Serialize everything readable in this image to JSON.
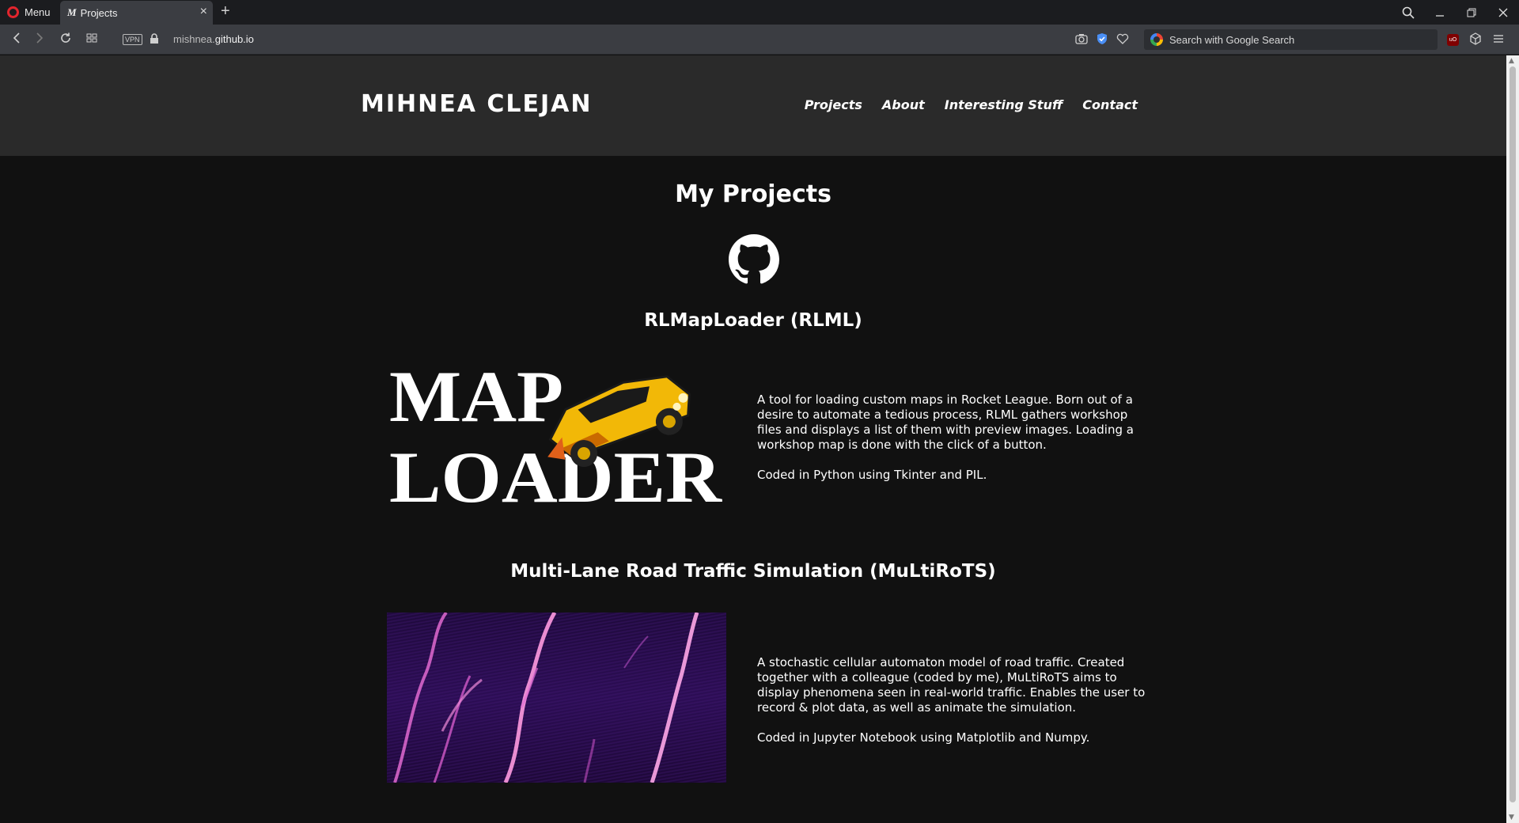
{
  "browser": {
    "menu_label": "Menu",
    "tab": {
      "favicon": "M",
      "title": "Projects"
    },
    "url_host_prefix": "mishnea.",
    "url_host_main": "github.io",
    "vpn_label": "VPN",
    "search_placeholder": "Search with Google Search",
    "ublock_label": "uO"
  },
  "site": {
    "brand": "MIHNEA CLEJAN",
    "nav": [
      "Projects",
      "About",
      "Interesting Stuff",
      "Contact"
    ]
  },
  "main": {
    "title": "My Projects",
    "projects": [
      {
        "title": "RLMapLoader (RLML)",
        "image_text_line1": "MAP",
        "image_text_line2": "LOADER",
        "description": "A tool for loading custom maps in Rocket League. Born out of a desire to automate a tedious process, RLML gathers workshop files and displays a list of them with preview images. Loading a workshop map is done with the click of a button.",
        "tech": "Coded in Python using Tkinter and PIL."
      },
      {
        "title": "Multi-Lane Road Traffic Simulation (MuLtiRoTS)",
        "description": "A stochastic cellular automaton model of road traffic. Created together with a colleague (coded by me), MuLtiRoTS aims to display phenomena seen in real-world traffic. Enables the user to record & plot data, as well as animate the simulation.",
        "tech": "Coded in Jupyter Notebook using Matplotlib and Numpy."
      }
    ]
  },
  "colors": {
    "page_bg": "#111111",
    "header_bg": "#2a2a2a",
    "text": "#ffffff",
    "browser_dark": "#1b1c1f",
    "browser_bar": "#3b3d42",
    "opera_red": "#e2252d"
  }
}
